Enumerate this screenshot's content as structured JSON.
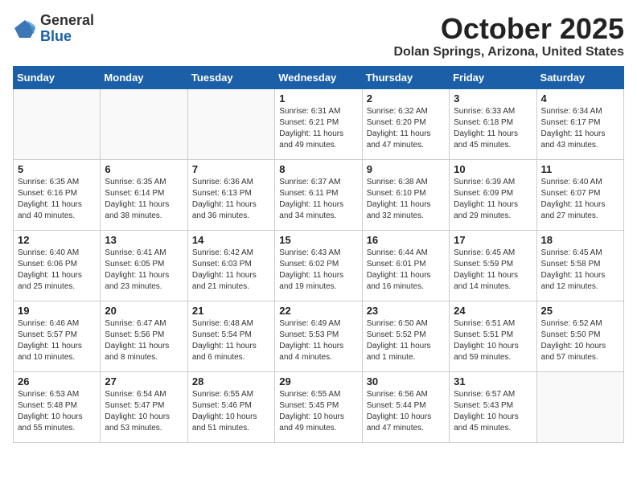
{
  "header": {
    "logo": {
      "general": "General",
      "blue": "Blue"
    },
    "month_title": "October 2025",
    "location": "Dolan Springs, Arizona, United States"
  },
  "weekdays": [
    "Sunday",
    "Monday",
    "Tuesday",
    "Wednesday",
    "Thursday",
    "Friday",
    "Saturday"
  ],
  "weeks": [
    [
      {
        "day": null,
        "info": null
      },
      {
        "day": null,
        "info": null
      },
      {
        "day": null,
        "info": null
      },
      {
        "day": "1",
        "info": "Sunrise: 6:31 AM\nSunset: 6:21 PM\nDaylight: 11 hours\nand 49 minutes."
      },
      {
        "day": "2",
        "info": "Sunrise: 6:32 AM\nSunset: 6:20 PM\nDaylight: 11 hours\nand 47 minutes."
      },
      {
        "day": "3",
        "info": "Sunrise: 6:33 AM\nSunset: 6:18 PM\nDaylight: 11 hours\nand 45 minutes."
      },
      {
        "day": "4",
        "info": "Sunrise: 6:34 AM\nSunset: 6:17 PM\nDaylight: 11 hours\nand 43 minutes."
      }
    ],
    [
      {
        "day": "5",
        "info": "Sunrise: 6:35 AM\nSunset: 6:16 PM\nDaylight: 11 hours\nand 40 minutes."
      },
      {
        "day": "6",
        "info": "Sunrise: 6:35 AM\nSunset: 6:14 PM\nDaylight: 11 hours\nand 38 minutes."
      },
      {
        "day": "7",
        "info": "Sunrise: 6:36 AM\nSunset: 6:13 PM\nDaylight: 11 hours\nand 36 minutes."
      },
      {
        "day": "8",
        "info": "Sunrise: 6:37 AM\nSunset: 6:11 PM\nDaylight: 11 hours\nand 34 minutes."
      },
      {
        "day": "9",
        "info": "Sunrise: 6:38 AM\nSunset: 6:10 PM\nDaylight: 11 hours\nand 32 minutes."
      },
      {
        "day": "10",
        "info": "Sunrise: 6:39 AM\nSunset: 6:09 PM\nDaylight: 11 hours\nand 29 minutes."
      },
      {
        "day": "11",
        "info": "Sunrise: 6:40 AM\nSunset: 6:07 PM\nDaylight: 11 hours\nand 27 minutes."
      }
    ],
    [
      {
        "day": "12",
        "info": "Sunrise: 6:40 AM\nSunset: 6:06 PM\nDaylight: 11 hours\nand 25 minutes."
      },
      {
        "day": "13",
        "info": "Sunrise: 6:41 AM\nSunset: 6:05 PM\nDaylight: 11 hours\nand 23 minutes."
      },
      {
        "day": "14",
        "info": "Sunrise: 6:42 AM\nSunset: 6:03 PM\nDaylight: 11 hours\nand 21 minutes."
      },
      {
        "day": "15",
        "info": "Sunrise: 6:43 AM\nSunset: 6:02 PM\nDaylight: 11 hours\nand 19 minutes."
      },
      {
        "day": "16",
        "info": "Sunrise: 6:44 AM\nSunset: 6:01 PM\nDaylight: 11 hours\nand 16 minutes."
      },
      {
        "day": "17",
        "info": "Sunrise: 6:45 AM\nSunset: 5:59 PM\nDaylight: 11 hours\nand 14 minutes."
      },
      {
        "day": "18",
        "info": "Sunrise: 6:45 AM\nSunset: 5:58 PM\nDaylight: 11 hours\nand 12 minutes."
      }
    ],
    [
      {
        "day": "19",
        "info": "Sunrise: 6:46 AM\nSunset: 5:57 PM\nDaylight: 11 hours\nand 10 minutes."
      },
      {
        "day": "20",
        "info": "Sunrise: 6:47 AM\nSunset: 5:56 PM\nDaylight: 11 hours\nand 8 minutes."
      },
      {
        "day": "21",
        "info": "Sunrise: 6:48 AM\nSunset: 5:54 PM\nDaylight: 11 hours\nand 6 minutes."
      },
      {
        "day": "22",
        "info": "Sunrise: 6:49 AM\nSunset: 5:53 PM\nDaylight: 11 hours\nand 4 minutes."
      },
      {
        "day": "23",
        "info": "Sunrise: 6:50 AM\nSunset: 5:52 PM\nDaylight: 11 hours\nand 1 minute."
      },
      {
        "day": "24",
        "info": "Sunrise: 6:51 AM\nSunset: 5:51 PM\nDaylight: 10 hours\nand 59 minutes."
      },
      {
        "day": "25",
        "info": "Sunrise: 6:52 AM\nSunset: 5:50 PM\nDaylight: 10 hours\nand 57 minutes."
      }
    ],
    [
      {
        "day": "26",
        "info": "Sunrise: 6:53 AM\nSunset: 5:48 PM\nDaylight: 10 hours\nand 55 minutes."
      },
      {
        "day": "27",
        "info": "Sunrise: 6:54 AM\nSunset: 5:47 PM\nDaylight: 10 hours\nand 53 minutes."
      },
      {
        "day": "28",
        "info": "Sunrise: 6:55 AM\nSunset: 5:46 PM\nDaylight: 10 hours\nand 51 minutes."
      },
      {
        "day": "29",
        "info": "Sunrise: 6:55 AM\nSunset: 5:45 PM\nDaylight: 10 hours\nand 49 minutes."
      },
      {
        "day": "30",
        "info": "Sunrise: 6:56 AM\nSunset: 5:44 PM\nDaylight: 10 hours\nand 47 minutes."
      },
      {
        "day": "31",
        "info": "Sunrise: 6:57 AM\nSunset: 5:43 PM\nDaylight: 10 hours\nand 45 minutes."
      },
      {
        "day": null,
        "info": null
      }
    ]
  ]
}
